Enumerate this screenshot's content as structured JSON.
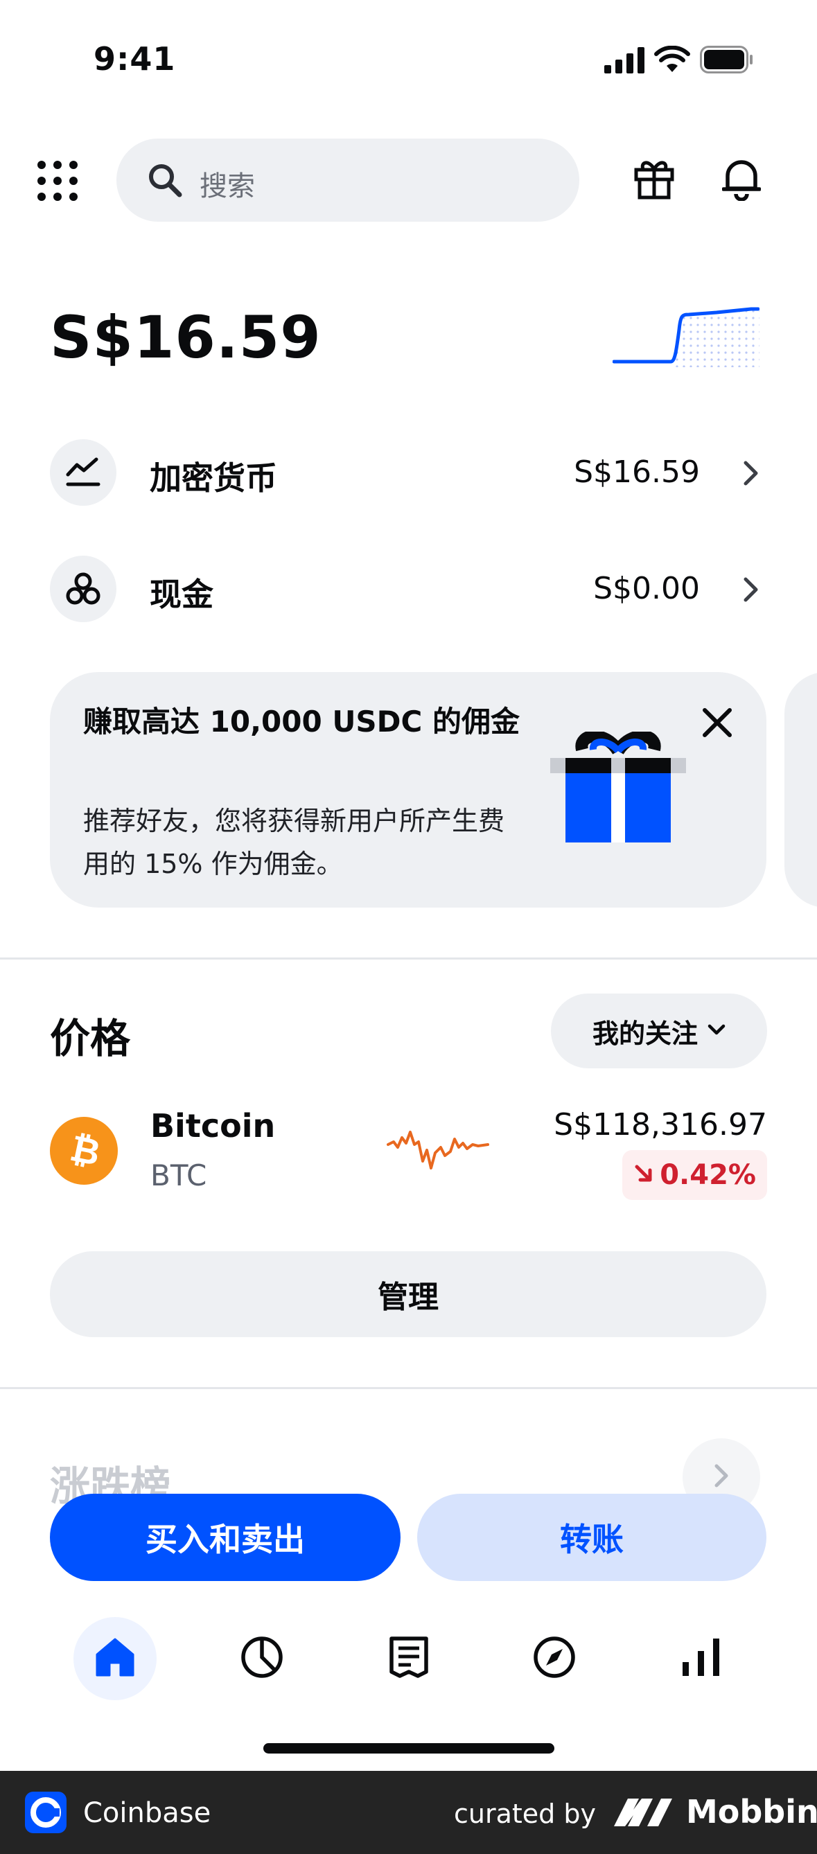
{
  "status_bar": {
    "time": "9:41"
  },
  "header": {
    "search_placeholder": "搜索",
    "icons": [
      "apps-grid-icon",
      "search-icon",
      "gift-icon",
      "bell-icon"
    ]
  },
  "portfolio": {
    "balance": "S$16.59",
    "rows": [
      {
        "label": "加密货币",
        "value": "S$16.59",
        "icon": "crypto-chart-icon"
      },
      {
        "label": "现金",
        "value": "S$0.00",
        "icon": "cash-coins-icon"
      }
    ]
  },
  "promo": {
    "title": "赚取高达 10,000 USDC 的佣金",
    "body": "推荐好友，您将获得新用户所产生费用的 15% 作为佣金。"
  },
  "prices": {
    "title": "价格",
    "filter_label": "我的关注",
    "assets": [
      {
        "name": "Bitcoin",
        "symbol": "BTC",
        "price": "S$118,316.97",
        "change": "0.42%",
        "direction": "down"
      }
    ],
    "manage_label": "管理"
  },
  "movers": {
    "title": "涨跌榜"
  },
  "actions": {
    "buy_sell": "买入和卖出",
    "transfer": "转账"
  },
  "tabs": [
    "home-icon",
    "portfolio-pie-icon",
    "transactions-receipt-icon",
    "explore-compass-icon",
    "markets-bars-icon"
  ],
  "footer": {
    "brand": "Coinbase",
    "curated_by": "curated by",
    "mobbin": "Mobbin"
  },
  "colors": {
    "accent": "#0052ff",
    "negative": "#cf202f",
    "bitcoin": "#f7931a",
    "surface": "#eef0f3"
  }
}
